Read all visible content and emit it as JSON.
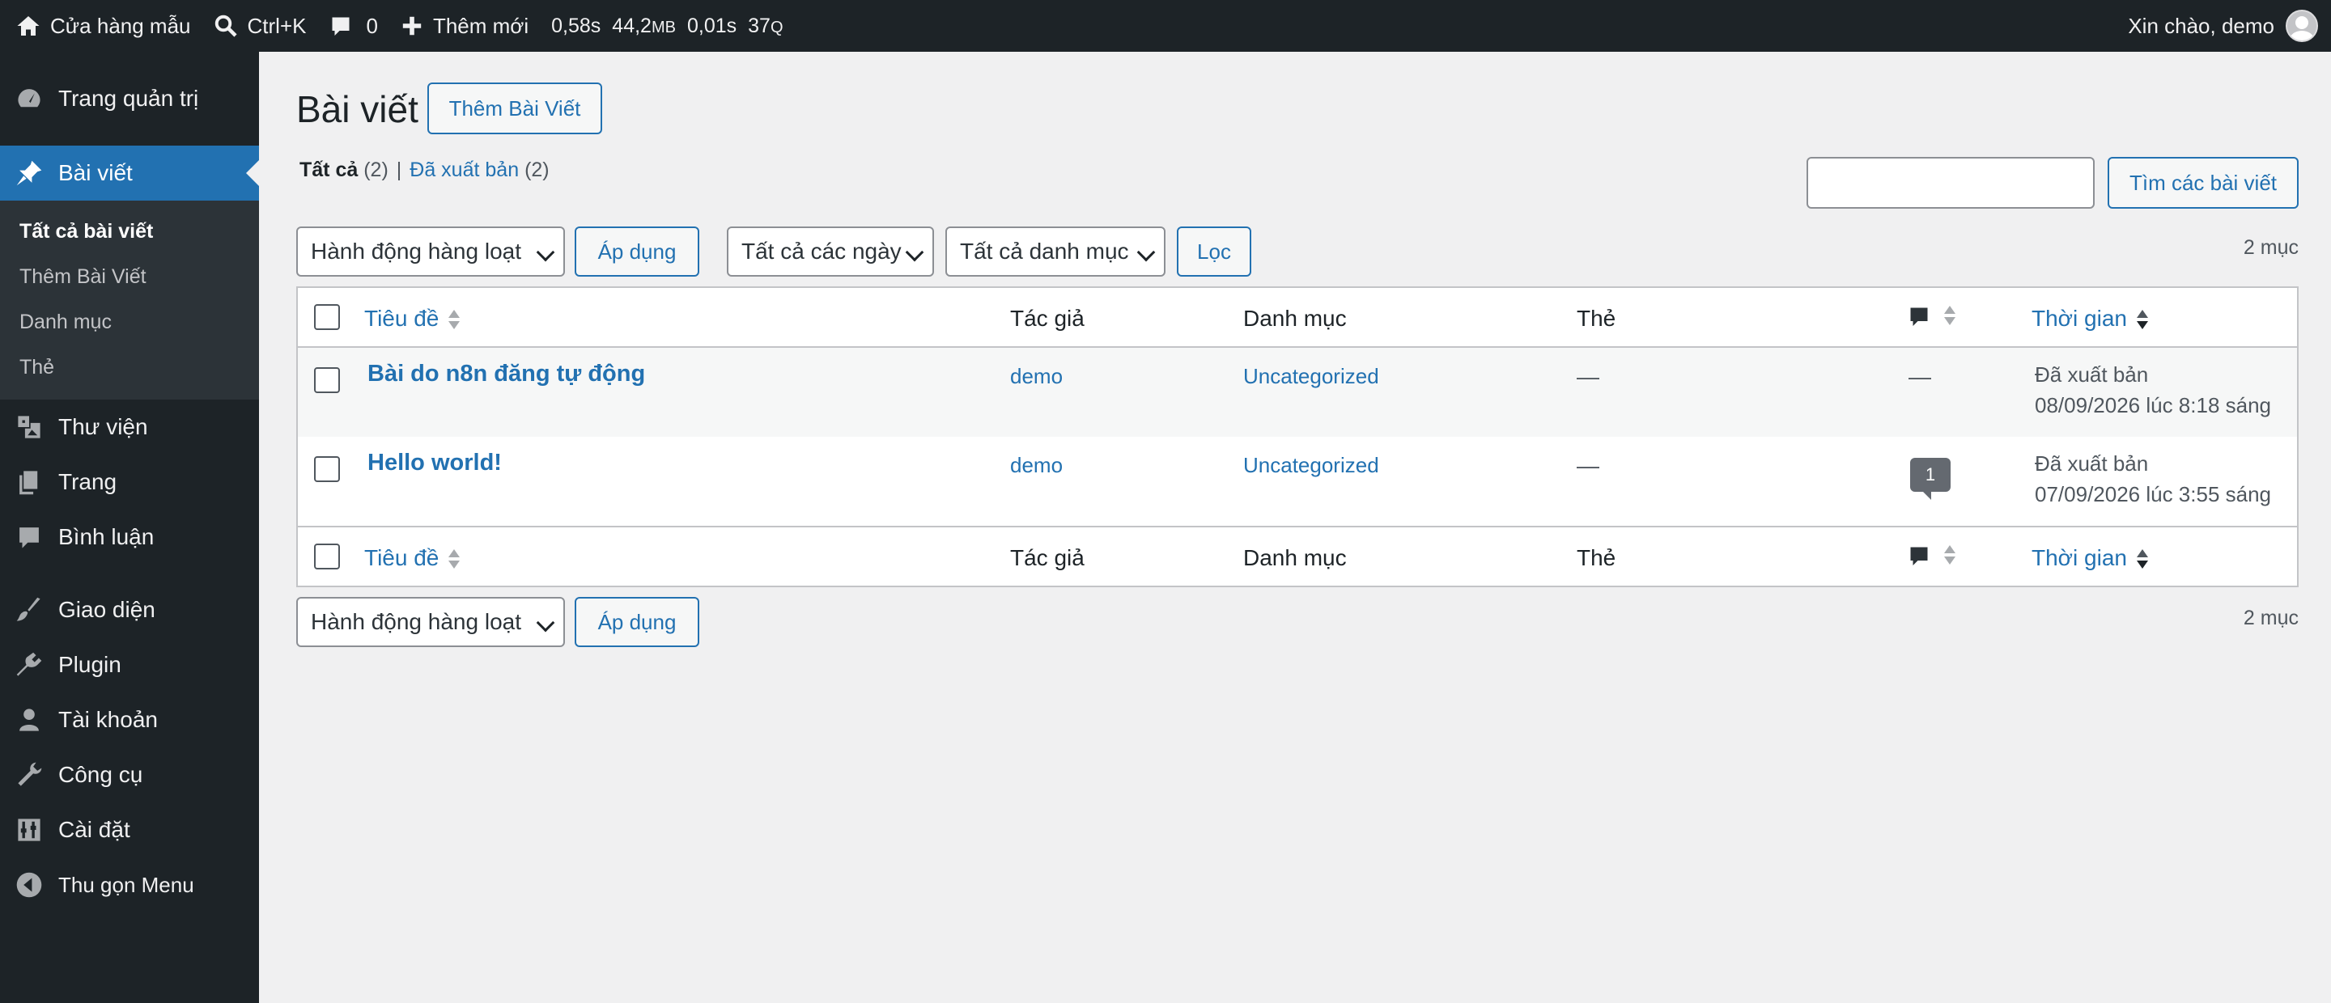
{
  "adminbar": {
    "site_name": "Cửa hàng mẫu",
    "search_shortcut": "Ctrl+K",
    "comments_count": "0",
    "new_label": "Thêm mới",
    "perf_time": "0,58s",
    "perf_mem": "44,2",
    "perf_mem_unit": "MB",
    "perf_query_time": "0,01s",
    "perf_queries": "37",
    "perf_queries_unit": "Q",
    "greeting": "Xin chào, demo"
  },
  "sidebar": {
    "dashboard": "Trang quản trị",
    "posts": "Bài viết",
    "posts_sub": [
      "Tất cả bài viết",
      "Thêm Bài Viết",
      "Danh mục",
      "Thẻ"
    ],
    "media": "Thư viện",
    "pages": "Trang",
    "comments": "Bình luận",
    "appearance": "Giao diện",
    "plugins": "Plugin",
    "users": "Tài khoản",
    "tools": "Công cụ",
    "settings": "Cài đặt",
    "collapse": "Thu gọn Menu"
  },
  "page": {
    "title": "Bài viết",
    "add_new": "Thêm Bài Viết",
    "filter_all": "Tất cả",
    "filter_all_count": "(2)",
    "filter_sep": "|",
    "filter_published": "Đã xuất bản",
    "filter_published_count": "(2)",
    "search_value": "",
    "search_button": "Tìm các bài viết",
    "bulk_action": "Hành động hàng loạt",
    "apply": "Áp dụng",
    "all_dates": "Tất cả các ngày",
    "all_categories": "Tất cả danh mục",
    "filter_button": "Lọc",
    "items_count": "2 mục"
  },
  "table": {
    "columns": {
      "title": "Tiêu đề",
      "author": "Tác giả",
      "categories": "Danh mục",
      "tags": "Thẻ",
      "date": "Thời gian"
    },
    "rows": [
      {
        "title": "Bài do n8n đăng tự động",
        "author": "demo",
        "category": "Uncategorized",
        "tags": "—",
        "comments": "—",
        "status": "Đã xuất bản",
        "date": "08/09/2026 lúc 8:18 sáng"
      },
      {
        "title": "Hello world!",
        "author": "demo",
        "category": "Uncategorized",
        "tags": "—",
        "comments": "1",
        "status": "Đã xuất bản",
        "date": "07/09/2026 lúc 3:55 sáng"
      }
    ]
  },
  "colors": {
    "adminbar_bg": "#1d2327",
    "accent": "#2271b1",
    "page_bg": "#f0f0f1"
  }
}
